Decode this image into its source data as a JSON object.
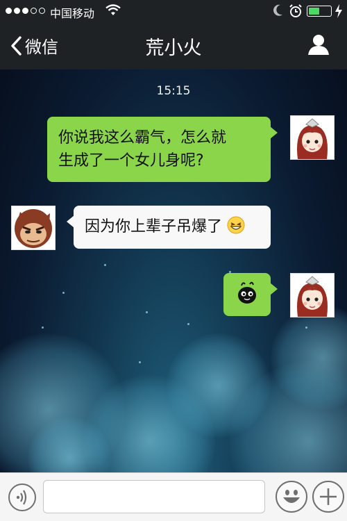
{
  "status_bar": {
    "carrier": "中国移动",
    "signal_icon": "signal-dots-icon",
    "wifi_icon": "wifi-icon",
    "moon_icon": "moon-icon",
    "alarm_icon": "alarm-icon",
    "battery_icon": "battery-icon",
    "battery_level": 0.5,
    "charging_icon": "bolt-icon"
  },
  "nav": {
    "back_label": "微信",
    "back_icon": "chevron-left-icon",
    "title": "荒小火",
    "profile_icon": "person-icon"
  },
  "chat": {
    "timestamp": "15:15",
    "messages": [
      {
        "direction": "outgoing",
        "lines": [
          "你说我这么霸气，怎么就",
          "生成了一个女儿身呢?"
        ]
      },
      {
        "direction": "incoming",
        "text": "因为你上辈子吊爆了",
        "emoji": "grin-emoji-icon"
      },
      {
        "direction": "outgoing",
        "sticker": "black-blob-sticker-icon"
      }
    ]
  },
  "input_bar": {
    "voice_icon": "voice-icon",
    "input_value": "",
    "emoji_icon": "smiley-icon",
    "plus_icon": "plus-icon"
  },
  "colors": {
    "bar_background": "#1f2224",
    "outgoing_bubble": "#8bd54b",
    "incoming_bubble": "#f8f8f8",
    "battery_fill": "#4cd964"
  }
}
